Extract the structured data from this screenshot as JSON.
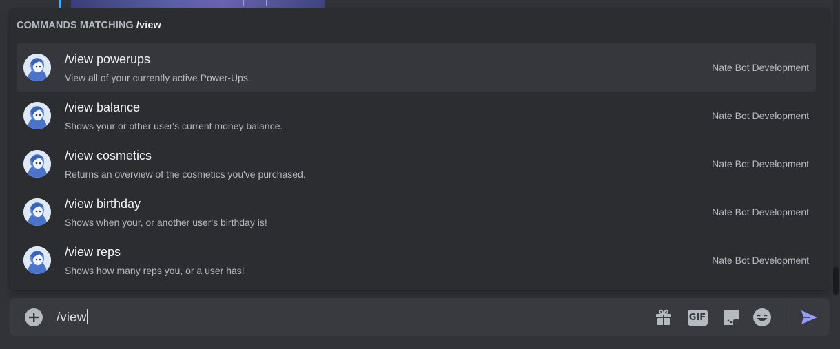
{
  "popup": {
    "header_prefix": "COMMANDS MATCHING",
    "header_query": "/view",
    "commands": [
      {
        "name": "/view powerups",
        "description": "View all of your currently active Power-Ups.",
        "source": "Nate Bot Development"
      },
      {
        "name": "/view balance",
        "description": "Shows your or other user's current money balance.",
        "source": "Nate Bot Development"
      },
      {
        "name": "/view cosmetics",
        "description": "Returns an overview of the cosmetics you've purchased.",
        "source": "Nate Bot Development"
      },
      {
        "name": "/view birthday",
        "description": "Shows when your, or another user's birthday is!",
        "source": "Nate Bot Development"
      },
      {
        "name": "/view reps",
        "description": "Shows how many reps you, or a user has!",
        "source": "Nate Bot Development"
      }
    ]
  },
  "chat_input": {
    "value": "/view",
    "icons": [
      "plus-icon",
      "gift-icon",
      "gif-icon",
      "sticker-icon",
      "emoji-icon",
      "send-icon"
    ],
    "gif_label": "GIF"
  },
  "colors": {
    "background": "#313338",
    "popup": "#2b2d31",
    "selected_row": "#35373c",
    "input": "#383a40",
    "send_accent": "#949cf7"
  }
}
